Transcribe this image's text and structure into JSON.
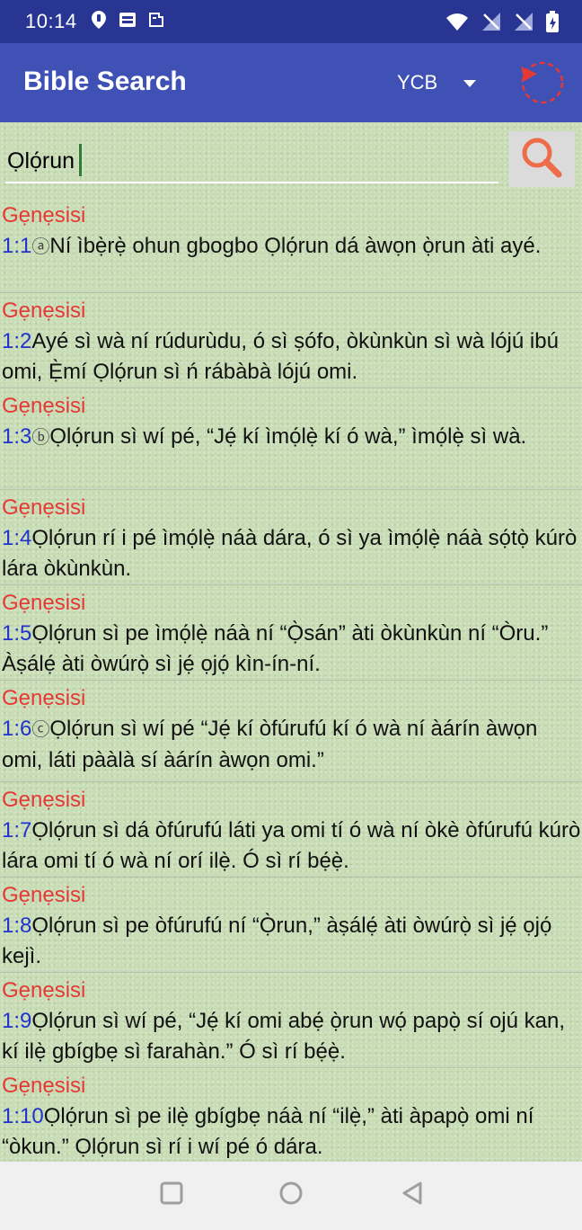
{
  "status": {
    "time": "10:14",
    "icons": [
      "location-icon",
      "sim-icon",
      "news-icon",
      "wifi-icon",
      "no-signal-icon",
      "no-signal-icon",
      "battery-icon"
    ]
  },
  "app_bar": {
    "title": "Bible Search",
    "version": "YCB"
  },
  "search": {
    "query": "Ọlọ́run",
    "button_icon": "search-icon"
  },
  "results": [
    {
      "book": "Gẹnẹsisi",
      "ref": "1:1",
      "fn": "ⓐ",
      "text": "Ní ìbẹ̀rẹ̀ ohun gbogbo Ọlọ́run dá àwọn ọ̀run àti ayé.",
      "tall": false
    },
    {
      "book": "Gẹnẹsisi",
      "ref": "1:2",
      "fn": "",
      "text": "Ayé sì wà ní rúdurùdu, ó sì ṣófo, òkùnkùn sì wà lójú ibú omi, Ẹ̀mí Ọlọ́run sì ń rábàbà lójú omi.",
      "tall": false
    },
    {
      "book": "Gẹnẹsisi",
      "ref": "1:3",
      "fn": "ⓑ",
      "text": "Ọlọ́run sì wí pé, “Jẹ́ kí ìmọ́lẹ̀ kí ó wà,” ìmọ́lẹ̀ sì wà.",
      "tall": true
    },
    {
      "book": "Gẹnẹsisi",
      "ref": "1:4",
      "fn": "",
      "text": "Ọlọ́run rí i pé ìmọ́lẹ̀ náà dára, ó sì ya ìmọ́lẹ̀ náà sọ́tọ̀ kúrò lára òkùnkùn.",
      "tall": false
    },
    {
      "book": "Gẹnẹsisi",
      "ref": "1:5",
      "fn": "",
      "text": "Ọlọ́run sì pe ìmọ́lẹ̀ náà ní “Ọ̀sán” àti òkùnkùn ní “Òru.” Àṣálẹ́ àti òwúrọ̀ sì jẹ́ ọjọ́ kìn-ín-ní.",
      "tall": false
    },
    {
      "book": "Gẹnẹsisi",
      "ref": "1:6",
      "fn": "ⓒ",
      "text": "Ọlọ́run sì wí pé “Jẹ́ kí òfúrufú kí ó wà ní àárín àwọn omi, láti pààlà sí àárín àwọn omi.”",
      "tall": true
    },
    {
      "book": "Gẹnẹsisi",
      "ref": "1:7",
      "fn": "",
      "text": "Ọlọ́run sì dá òfúrufú láti ya omi tí ó wà ní òkè òfúrufú kúrò lára omi tí ó wà ní orí ilẹ̀. Ó sì rí bẹ́ẹ̀.",
      "tall": false
    },
    {
      "book": "Gẹnẹsisi",
      "ref": "1:8",
      "fn": "",
      "text": "Ọlọ́run sì pe òfúrufú ní “Ọ̀run,” àṣálẹ́ àti òwúrọ̀ sì jẹ́ ọjọ́ kejì.",
      "tall": false
    },
    {
      "book": "Gẹnẹsisi",
      "ref": "1:9",
      "fn": "",
      "text": "Ọlọ́run sì wí pé, “Jẹ́ kí omi abẹ́ ọ̀run wọ́ papọ̀ sí ojú kan, kí ilẹ̀ gbígbẹ sì farahàn.” Ó sì rí bẹ́ẹ̀.",
      "tall": false
    },
    {
      "book": "Gẹnẹsisi",
      "ref": "1:10",
      "fn": "",
      "text": "Ọlọ́run sì pe ilẹ̀ gbígbẹ náà ní “ilẹ̀,” àti àpapọ̀ omi ní “òkun.” Ọlọ́run sì rí i wí pé ó dára.",
      "tall": false
    }
  ],
  "nav": [
    "recents-button",
    "home-button",
    "back-button"
  ],
  "colors": {
    "status_bar": "#283593",
    "app_bar": "#3f51b5",
    "book_red": "#e53935",
    "ref_blue": "#2233cc",
    "refresh_red": "#e53935",
    "search_icon": "#ef6c4a"
  }
}
